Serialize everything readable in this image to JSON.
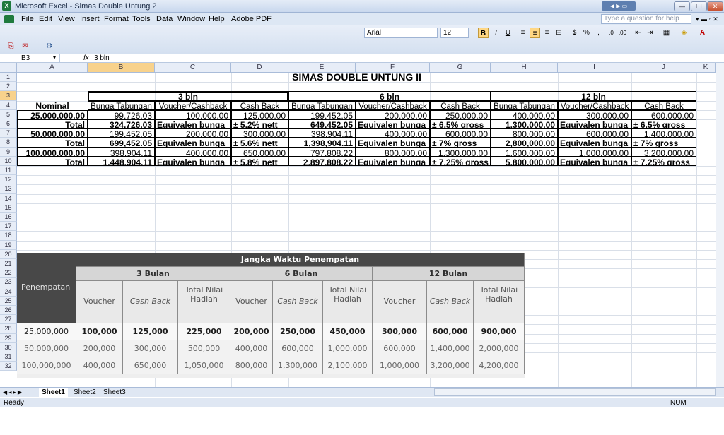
{
  "window": {
    "title": "Microsoft Excel - Simas Double Untung 2",
    "app_icon": "excel-icon"
  },
  "menu": {
    "items": [
      "File",
      "Edit",
      "View",
      "Insert",
      "Format",
      "Tools",
      "Data",
      "Window",
      "Help",
      "Adobe PDF"
    ],
    "help_placeholder": "Type a question for help"
  },
  "format_toolbar": {
    "font": "Arial",
    "size": "12",
    "bold": "B",
    "italic": "I",
    "underline": "U",
    "currency": "$",
    "percent": "%",
    "comma": ","
  },
  "formula_bar": {
    "name_box": "B3",
    "fx": "fx",
    "value": "3 bln"
  },
  "columns": [
    "A",
    "B",
    "C",
    "D",
    "E",
    "F",
    "G",
    "H",
    "I",
    "J",
    "K"
  ],
  "selected_column": "B",
  "selected_row": "3",
  "rows": [
    "1",
    "2",
    "3",
    "4",
    "5",
    "6",
    "7",
    "8",
    "9",
    "10",
    "11",
    "12",
    "13",
    "14",
    "15",
    "16",
    "17",
    "18",
    "19",
    "20",
    "21",
    "22",
    "23",
    "24",
    "25",
    "26",
    "27",
    "28",
    "29",
    "30",
    "31",
    "32"
  ],
  "sheet": {
    "title": "SIMAS DOUBLE UNTUNG II",
    "periods": [
      "3 bln",
      "6 bln",
      "12 bln"
    ],
    "header": {
      "nominal": "Nominal",
      "sub": [
        "Bunga Tabungan",
        "Voucher/Cashback",
        "Cash Back",
        "Bunga Tabungan",
        "Voucher/Cashback",
        "Cash Back",
        "Bunga Tabungan",
        "Voucher/Cashback",
        "Cash Back"
      ]
    },
    "data_rows": [
      {
        "a": "25,000,000.00",
        "vals": [
          "99,726.03",
          "100,000.00",
          "125,000.00",
          "199,452.05",
          "200,000.00",
          "250,000.00",
          "400,000.00",
          "300,000.00",
          "600,000.00"
        ]
      },
      {
        "a": "Total",
        "vals": [
          "324,726.03",
          "Equivalen bunga",
          "± 5.2% nett",
          "649,452.05",
          "Equivalen bunga",
          "± 6.5% gross",
          "1,300,000.00",
          "Equivalen bunga",
          "± 6.5% gross"
        ]
      },
      {
        "a": "50,000,000.00",
        "vals": [
          "199,452.05",
          "200,000.00",
          "300,000.00",
          "398,904.11",
          "400,000.00",
          "600,000.00",
          "800,000.00",
          "600,000.00",
          "1,400,000.00"
        ]
      },
      {
        "a": "Total",
        "vals": [
          "699,452.05",
          "Equivalen bunga",
          "± 5.6% nett",
          "1,398,904.11",
          "Equivalen bunga",
          "± 7% gross",
          "2,800,000.00",
          "Equivalen bunga",
          "± 7% gross"
        ]
      },
      {
        "a": "100,000,000.00",
        "vals": [
          "398,904.11",
          "400,000.00",
          "650,000.00",
          "797,808.22",
          "800,000.00",
          "1,300,000.00",
          "1,600,000.00",
          "1,000,000.00",
          "3,200,000.00"
        ]
      },
      {
        "a": "Total",
        "vals": [
          "1,448,904.11",
          "Equivalen bunga",
          "± 5.8% nett",
          "2,897,808.22",
          "Equivalen bunga",
          "± 7.25% gross",
          "5,800,000.00",
          "Equivalen bunga",
          "± 7.25% gross"
        ]
      }
    ]
  },
  "photo_table": {
    "title": "Jangka Waktu Penempatan",
    "row_header": "Penempatan",
    "periods": [
      "3 Bulan",
      "6 Bulan",
      "12 Bulan"
    ],
    "sub": [
      "Voucher",
      "Cash Back",
      "Total Nilai Hadiah"
    ],
    "rows": [
      [
        "25,000,000",
        "100,000",
        "125,000",
        "225,000",
        "200,000",
        "250,000",
        "450,000",
        "300,000",
        "600,000",
        "900,000"
      ],
      [
        "50,000,000",
        "200,000",
        "300,000",
        "500,000",
        "400,000",
        "600,000",
        "1,000,000",
        "600,000",
        "1,400,000",
        "2,000,000"
      ],
      [
        "100,000,000",
        "400,000",
        "650,000",
        "1,050,000",
        "800,000",
        "1,300,000",
        "2,100,000",
        "1,000,000",
        "3,200,000",
        "4,200,000"
      ]
    ]
  },
  "tabs": [
    "Sheet1",
    "Sheet2",
    "Sheet3"
  ],
  "status": {
    "left": "Ready",
    "num": "NUM"
  }
}
